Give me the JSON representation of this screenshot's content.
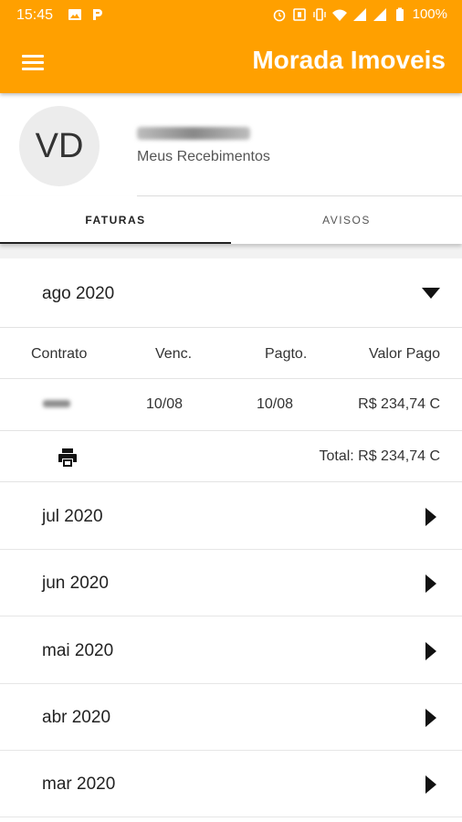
{
  "status_bar": {
    "time": "15:45",
    "battery": "100%",
    "icons": [
      "image-icon",
      "parking-app-icon",
      "alarm-icon",
      "nfc-icon",
      "vibrate-icon",
      "wifi-icon",
      "signal-icon",
      "signal-icon",
      "battery-icon"
    ]
  },
  "app_bar": {
    "title": "Morada Imoveis",
    "background": "#ffa000"
  },
  "profile": {
    "initials": "VD",
    "subtitle": "Meus Recebimentos"
  },
  "tabs": [
    {
      "label": "FATURAS",
      "active": true
    },
    {
      "label": "AVISOS",
      "active": false
    }
  ],
  "expanded_month": {
    "label": "ago 2020",
    "columns": [
      "Contrato",
      "Venc.",
      "Pagto.",
      "Valor Pago"
    ],
    "rows": [
      {
        "contrato": "",
        "venc": "10/08",
        "pagto": "10/08",
        "valor": "R$ 234,74 C"
      }
    ],
    "total": "Total: R$ 234,74 C"
  },
  "months": [
    {
      "label": "jul 2020"
    },
    {
      "label": "jun 2020"
    },
    {
      "label": "mai 2020"
    },
    {
      "label": "abr 2020"
    },
    {
      "label": "mar 2020"
    }
  ]
}
